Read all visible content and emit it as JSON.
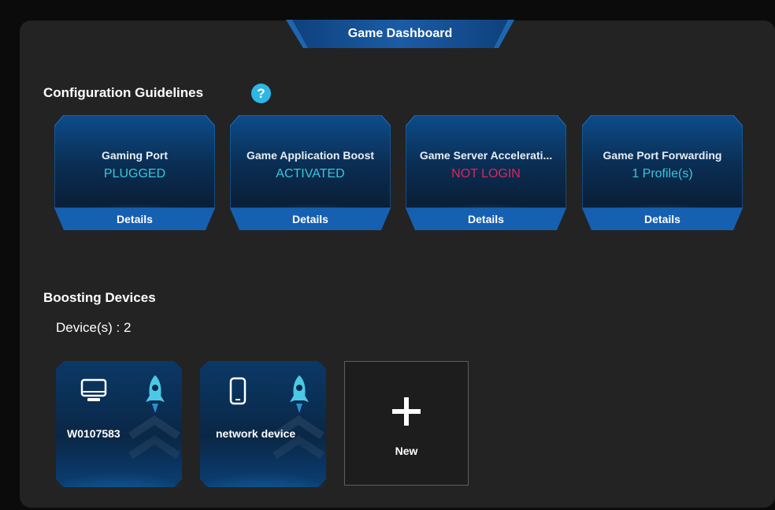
{
  "header": {
    "title": "Game Dashboard"
  },
  "guidelines": {
    "heading": "Configuration Guidelines",
    "help_icon": "question-icon",
    "cards": [
      {
        "title": "Gaming Port",
        "status": "PLUGGED",
        "status_color": "#35c9de",
        "details_label": "Details"
      },
      {
        "title": "Game Application Boost",
        "status": "ACTIVATED",
        "status_color": "#35c9de",
        "details_label": "Details"
      },
      {
        "title": "Game Server Accelerati...",
        "status": "NOT LOGIN",
        "status_color": "#e0245e",
        "details_label": "Details"
      },
      {
        "title": "Game Port Forwarding",
        "status": "1 Profile(s)",
        "status_color": "#35c9de",
        "details_label": "Details"
      }
    ]
  },
  "boosting": {
    "heading": "Boosting Devices",
    "count_text": "Device(s) : 2",
    "devices": [
      {
        "name": "W0107583",
        "icon": "monitor-icon",
        "boost_icon": "rocket-icon"
      },
      {
        "name": "network device",
        "icon": "phone-icon",
        "boost_icon": "rocket-icon"
      }
    ],
    "add_label": "New"
  },
  "colors": {
    "accent": "#35c9de",
    "alert": "#e0245e",
    "panel": "#232323",
    "card_blue": "#0b5fa8"
  }
}
